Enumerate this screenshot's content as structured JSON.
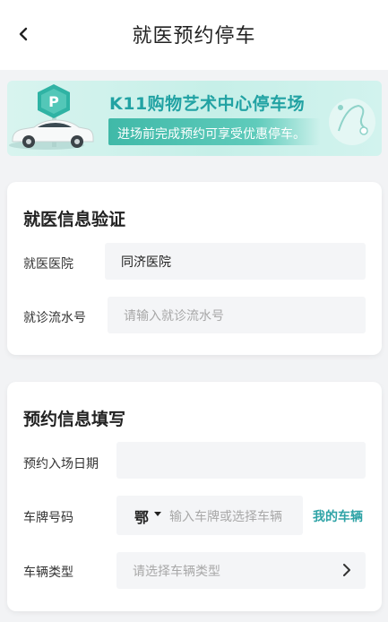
{
  "header": {
    "title": "就医预约停车",
    "back_icon": "chevron-left-icon"
  },
  "banner": {
    "title": "K11购物艺术中心停车场",
    "subtitle": "进场前完成预约可享受优惠停车。",
    "accent": "#21a2a3",
    "sign_letter": "P"
  },
  "medical": {
    "title": "就医信息验证",
    "hospital_label": "就医医院",
    "hospital_value": "同济医院",
    "serial_label": "就诊流水号",
    "serial_placeholder": "请输入就诊流水号"
  },
  "booking": {
    "title": "预约信息填写",
    "date_label": "预约入场日期",
    "date_value": "",
    "plate_label": "车牌号码",
    "province": "鄂",
    "plate_placeholder": "输入车牌或选择车辆",
    "my_vehicles": "我的车辆",
    "type_label": "车辆类型",
    "type_placeholder": "请选择车辆类型"
  }
}
